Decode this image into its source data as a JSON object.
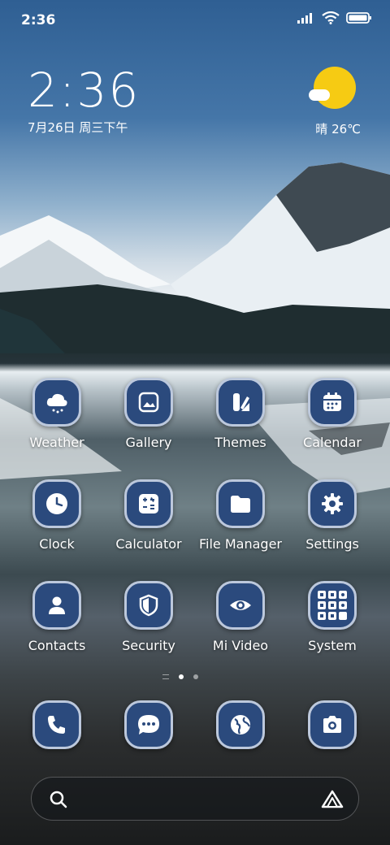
{
  "status_bar": {
    "time": "2:36",
    "icons": [
      "signal-icon",
      "wifi-icon",
      "battery-icon"
    ]
  },
  "clock_widget": {
    "time": "2:36",
    "date": "7月26日 周三下午"
  },
  "weather_widget": {
    "icon": "sunny-cloud-icon",
    "text": "晴 26℃"
  },
  "apps": [
    {
      "label": "Weather",
      "icon": "weather-icon"
    },
    {
      "label": "Gallery",
      "icon": "gallery-icon"
    },
    {
      "label": "Themes",
      "icon": "themes-icon"
    },
    {
      "label": "Calendar",
      "icon": "calendar-icon"
    },
    {
      "label": "Clock",
      "icon": "clock-icon"
    },
    {
      "label": "Calculator",
      "icon": "calculator-icon"
    },
    {
      "label": "File Manager",
      "icon": "folder-icon"
    },
    {
      "label": "Settings",
      "icon": "gear-icon"
    },
    {
      "label": "Contacts",
      "icon": "person-icon"
    },
    {
      "label": "Security",
      "icon": "shield-icon"
    },
    {
      "label": "Mi Video",
      "icon": "eye-icon"
    },
    {
      "label": "System",
      "icon": "folder-grid-icon"
    }
  ],
  "page_indicator": {
    "pages": 2,
    "current": 1
  },
  "dock": [
    "phone-icon",
    "messages-icon",
    "browser-icon",
    "camera-icon"
  ],
  "search_bar": {
    "left_icon": "search-icon",
    "right_icon": "assistant-icon"
  },
  "colors": {
    "icon_bg": "#2b4a7d",
    "icon_border": "#bcc8dc",
    "sun": "#f6cb13"
  }
}
